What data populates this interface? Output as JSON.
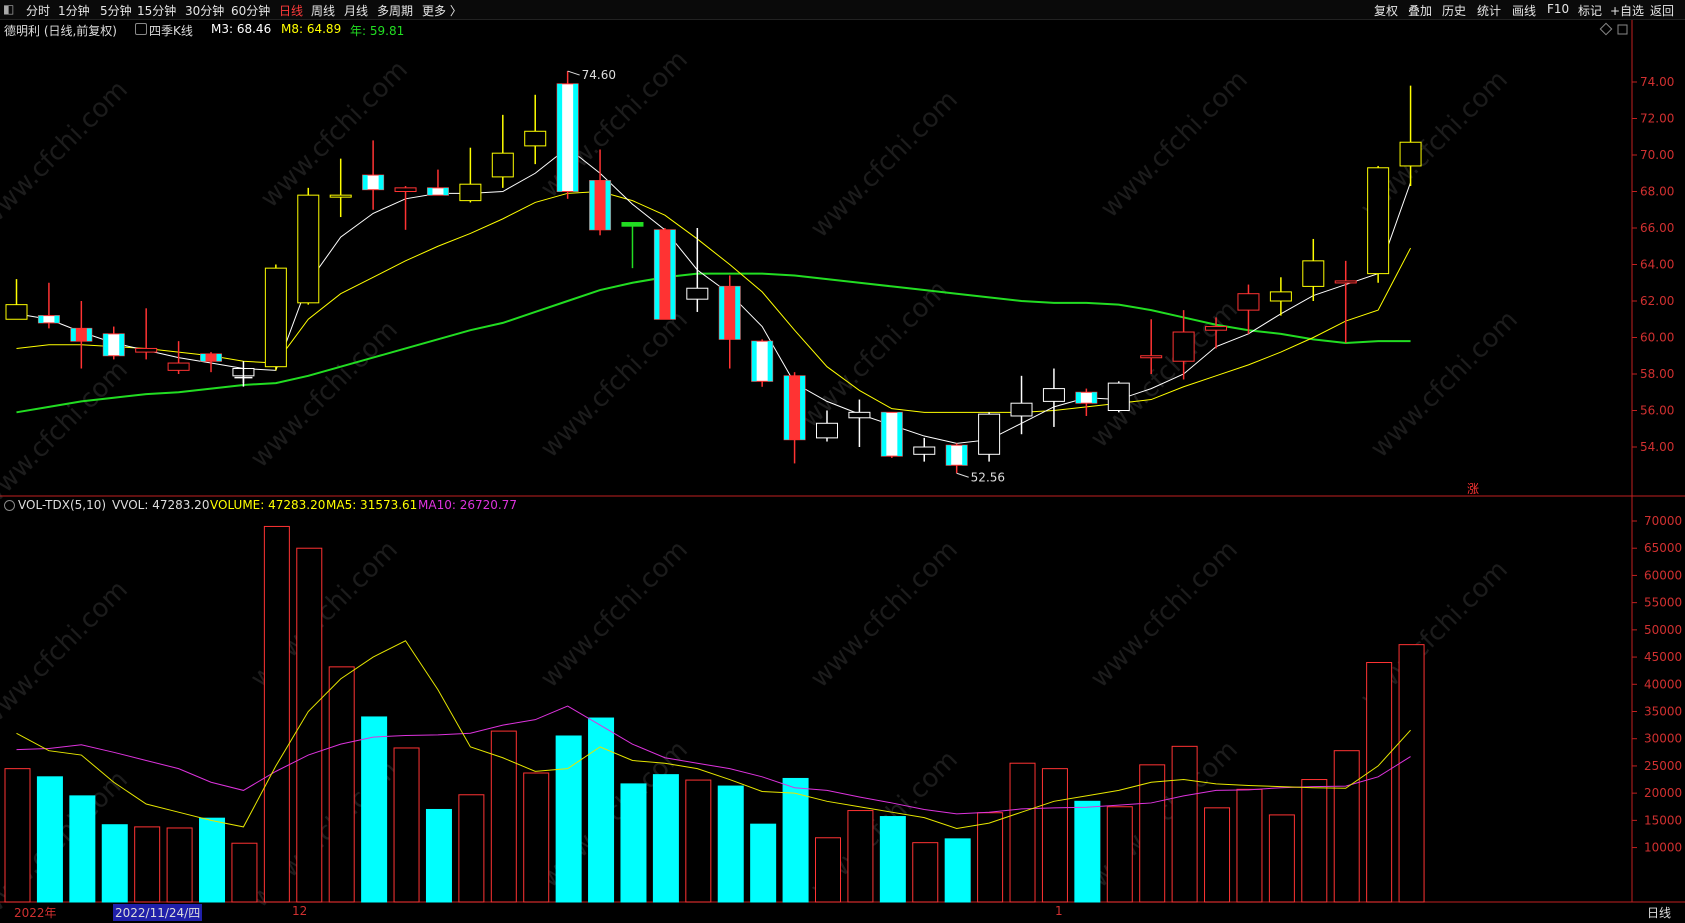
{
  "toolbar": {
    "left": [
      "分时",
      "1分钟",
      "5分钟",
      "15分钟",
      "30分钟",
      "60分钟",
      "日线",
      "周线",
      "月线",
      "多周期",
      "更多 〉"
    ],
    "active": "日线",
    "right": [
      "复权",
      "叠加",
      "历史",
      "统计",
      "画线",
      "F10",
      "标记",
      "+自选",
      "返回"
    ]
  },
  "main_title": {
    "stock": "德明利 (日线,前复权)",
    "indicator": "四季K线",
    "m3": "M3: 68.46",
    "m8": "M8: 64.89",
    "year": "年: 59.81"
  },
  "vol_title": {
    "name": "VOL-TDX(5,10)",
    "vvol": "VVOL: 47283.20",
    "volume": "VOLUME: 47283.20",
    "ma5": "MA5: 31573.61",
    "ma10": "MA10: 26720.77"
  },
  "colors": {
    "up": "#ff3333",
    "down": "#00ffff",
    "white_k": "#ffffff",
    "yellow_k": "#ffff00",
    "m3": "#ffffff",
    "m8": "#ffff00",
    "year": "#22dd22",
    "ma10": "#dd33dd",
    "ma5": "#e6e600",
    "axis": "#c02020"
  },
  "price_axis": [
    "74.00",
    "72.00",
    "70.00",
    "68.00",
    "66.00",
    "64.00",
    "62.00",
    "60.00",
    "58.00",
    "56.00",
    "54.00"
  ],
  "vol_axis": [
    "70000",
    "65000",
    "60000",
    "55000",
    "50000",
    "45000",
    "40000",
    "35000",
    "30000",
    "25000",
    "20000",
    "15000",
    "10000"
  ],
  "annotations": {
    "high": "74.60",
    "low": "52.56",
    "zhang": "涨"
  },
  "footer": {
    "year": "2022年",
    "date": "2022/11/24/四",
    "month1": "12",
    "month2": "1",
    "period": "日线"
  },
  "watermark": "www.cfchi.com",
  "chart_data": {
    "type": "candlestick",
    "price_ylim": [
      52.5,
      75
    ],
    "volume_ylim": [
      0,
      70000
    ],
    "candles": [
      {
        "o": 61.8,
        "h": 63.2,
        "l": 61.2,
        "c": 61.0,
        "k": "yellow",
        "v": 24500
      },
      {
        "o": 61.2,
        "h": 63.0,
        "l": 60.5,
        "c": 60.8,
        "k": "down",
        "v": 23000
      },
      {
        "o": 60.5,
        "h": 62.0,
        "l": 58.3,
        "c": 59.8,
        "k": "down",
        "v": 19500
      },
      {
        "o": 60.2,
        "h": 60.6,
        "l": 58.8,
        "c": 59.0,
        "k": "down",
        "v": 14200
      },
      {
        "o": 59.4,
        "h": 61.6,
        "l": 58.8,
        "c": 59.2,
        "k": "up",
        "v": 13800
      },
      {
        "o": 58.6,
        "h": 59.8,
        "l": 58.0,
        "c": 58.2,
        "k": "up",
        "v": 13600
      },
      {
        "o": 59.1,
        "h": 59.2,
        "l": 58.1,
        "c": 58.7,
        "k": "down",
        "v": 15400
      },
      {
        "o": 58.3,
        "h": 58.7,
        "l": 57.5,
        "c": 57.9,
        "k": "white",
        "v": 10800
      },
      {
        "o": 58.4,
        "h": 64.0,
        "l": 58.2,
        "c": 63.8,
        "k": "yellow",
        "v": 69000
      },
      {
        "o": 61.9,
        "h": 68.2,
        "l": 61.8,
        "c": 67.8,
        "k": "yellow",
        "v": 65000
      },
      {
        "o": 67.8,
        "h": 69.8,
        "l": 66.6,
        "c": 67.8,
        "k": "yellow",
        "v": 43200
      },
      {
        "o": 68.9,
        "h": 70.8,
        "l": 67.0,
        "c": 68.1,
        "k": "down",
        "v": 34000
      },
      {
        "o": 68.2,
        "h": 68.3,
        "l": 65.9,
        "c": 68.0,
        "k": "up",
        "v": 28300
      },
      {
        "o": 68.2,
        "h": 69.2,
        "l": 67.8,
        "c": 67.8,
        "k": "down",
        "v": 17000
      },
      {
        "o": 67.5,
        "h": 70.4,
        "l": 67.4,
        "c": 68.4,
        "k": "yellow",
        "v": 19700
      },
      {
        "o": 68.8,
        "h": 72.2,
        "l": 68.2,
        "c": 70.1,
        "k": "yellow",
        "v": 31400
      },
      {
        "o": 70.5,
        "h": 73.3,
        "l": 69.5,
        "c": 71.3,
        "k": "yellow",
        "v": 23700
      },
      {
        "o": 73.9,
        "h": 74.6,
        "l": 67.6,
        "c": 68.0,
        "k": "down",
        "v": 30500
      },
      {
        "o": 68.6,
        "h": 70.3,
        "l": 65.6,
        "c": 65.9,
        "k": "down",
        "v": 33800
      },
      {
        "o": 66.3,
        "h": 66.3,
        "l": 63.8,
        "c": 66.1,
        "k": "green",
        "v": 21700
      },
      {
        "o": 65.9,
        "h": 66.0,
        "l": 61.0,
        "c": 61.0,
        "k": "down",
        "v": 23400
      },
      {
        "o": 62.1,
        "h": 66.0,
        "l": 61.4,
        "c": 62.7,
        "k": "white",
        "v": 22400
      },
      {
        "o": 62.8,
        "h": 63.4,
        "l": 58.3,
        "c": 59.9,
        "k": "down",
        "v": 21300
      },
      {
        "o": 59.8,
        "h": 59.9,
        "l": 57.3,
        "c": 57.6,
        "k": "down",
        "v": 14300
      },
      {
        "o": 57.9,
        "h": 58.1,
        "l": 53.1,
        "c": 54.4,
        "k": "down",
        "v": 22700
      },
      {
        "o": 55.3,
        "h": 56.0,
        "l": 54.3,
        "c": 54.5,
        "k": "white",
        "v": 11800
      },
      {
        "o": 55.6,
        "h": 56.6,
        "l": 54.0,
        "c": 55.9,
        "k": "white",
        "v": 16800
      },
      {
        "o": 55.9,
        "h": 55.9,
        "l": 53.4,
        "c": 53.5,
        "k": "down",
        "v": 15700
      },
      {
        "o": 53.6,
        "h": 54.5,
        "l": 53.2,
        "c": 54.0,
        "k": "white",
        "v": 10900
      },
      {
        "o": 54.1,
        "h": 54.2,
        "l": 52.56,
        "c": 53.0,
        "k": "down",
        "v": 11600
      },
      {
        "o": 53.6,
        "h": 55.9,
        "l": 53.2,
        "c": 55.8,
        "k": "white",
        "v": 16400
      },
      {
        "o": 55.7,
        "h": 57.9,
        "l": 54.7,
        "c": 56.4,
        "k": "white",
        "v": 25500
      },
      {
        "o": 56.5,
        "h": 58.3,
        "l": 55.1,
        "c": 57.2,
        "k": "white",
        "v": 24500
      },
      {
        "o": 57.0,
        "h": 57.2,
        "l": 55.7,
        "c": 56.4,
        "k": "down",
        "v": 18500
      },
      {
        "o": 56.0,
        "h": 57.6,
        "l": 55.9,
        "c": 57.5,
        "k": "white",
        "v": 17500
      },
      {
        "o": 59.0,
        "h": 61.0,
        "l": 58.0,
        "c": 59.0,
        "k": "up",
        "v": 25200
      },
      {
        "o": 58.7,
        "h": 61.5,
        "l": 57.7,
        "c": 60.3,
        "k": "up",
        "v": 28600
      },
      {
        "o": 60.4,
        "h": 61.1,
        "l": 59.4,
        "c": 60.6,
        "k": "up",
        "v": 17300
      },
      {
        "o": 61.5,
        "h": 62.9,
        "l": 60.2,
        "c": 62.4,
        "k": "up",
        "v": 20700
      },
      {
        "o": 62.0,
        "h": 63.3,
        "l": 61.2,
        "c": 62.5,
        "k": "yellow",
        "v": 16000
      },
      {
        "o": 62.8,
        "h": 65.4,
        "l": 62.0,
        "c": 64.2,
        "k": "yellow",
        "v": 22500
      },
      {
        "o": 63.1,
        "h": 64.2,
        "l": 59.7,
        "c": 63.0,
        "k": "up",
        "v": 27800
      },
      {
        "o": 63.5,
        "h": 69.4,
        "l": 63.0,
        "c": 69.3,
        "k": "yellow",
        "v": 44000
      },
      {
        "o": 69.4,
        "h": 73.8,
        "l": 68.3,
        "c": 70.7,
        "k": "yellow",
        "v": 47283
      }
    ],
    "m3": [
      61.3,
      61.0,
      60.3,
      59.7,
      59.3,
      58.9,
      58.6,
      58.3,
      58.2,
      63.0,
      65.5,
      66.8,
      67.6,
      67.9,
      67.9,
      68.0,
      69.0,
      70.4,
      69.0,
      67.3,
      65.9,
      63.7,
      62.4,
      60.6,
      57.5,
      56.5,
      55.8,
      55.2,
      54.6,
      54.2,
      54.4,
      55.3,
      56.2,
      56.7,
      56.6,
      57.2,
      58.0,
      59.5,
      60.2,
      61.3,
      62.3,
      62.9,
      63.5,
      68.5
    ],
    "m8": [
      59.4,
      59.6,
      59.6,
      59.5,
      59.4,
      59.2,
      59.0,
      58.7,
      58.6,
      61.0,
      62.4,
      63.3,
      64.2,
      65.0,
      65.7,
      66.5,
      67.4,
      67.9,
      68.0,
      67.5,
      66.7,
      65.4,
      64.0,
      62.5,
      60.4,
      58.4,
      57.1,
      56.1,
      55.9,
      55.9,
      55.9,
      55.9,
      56.0,
      56.2,
      56.4,
      56.6,
      57.3,
      57.9,
      58.5,
      59.2,
      60.0,
      60.9,
      61.5,
      64.9
    ],
    "year_line": [
      55.9,
      56.2,
      56.5,
      56.7,
      56.9,
      57.0,
      57.2,
      57.4,
      57.5,
      57.9,
      58.4,
      58.9,
      59.4,
      59.9,
      60.4,
      60.8,
      61.4,
      62.0,
      62.6,
      63.0,
      63.3,
      63.5,
      63.5,
      63.5,
      63.4,
      63.2,
      63.0,
      62.8,
      62.6,
      62.4,
      62.2,
      62.0,
      61.9,
      61.9,
      61.8,
      61.5,
      61.1,
      60.7,
      60.4,
      60.2,
      59.9,
      59.7,
      59.8,
      59.8
    ],
    "vol_ma5": [
      31000,
      27800,
      27000,
      22000,
      18000,
      16500,
      15000,
      13800,
      25000,
      35000,
      41000,
      45000,
      48000,
      39000,
      28500,
      26500,
      24000,
      24500,
      28500,
      26000,
      25500,
      24500,
      22500,
      20300,
      20000,
      18500,
      17500,
      16500,
      15500,
      13500,
      14500,
      16500,
      18500,
      19500,
      20500,
      22000,
      22500,
      21700,
      21400,
      21200,
      21000,
      20900,
      25000,
      31573
    ],
    "vol_ma10": [
      28000,
      28200,
      28900,
      27500,
      26000,
      24500,
      22000,
      20500,
      24000,
      27000,
      29000,
      30300,
      30600,
      30700,
      31000,
      32500,
      33500,
      36000,
      32500,
      29000,
      26500,
      25500,
      24500,
      23000,
      21000,
      20500,
      19300,
      18200,
      17000,
      16200,
      16500,
      17100,
      17300,
      17400,
      17800,
      18200,
      19500,
      20500,
      20600,
      21000,
      21200,
      21300,
      23000,
      26721
    ]
  }
}
